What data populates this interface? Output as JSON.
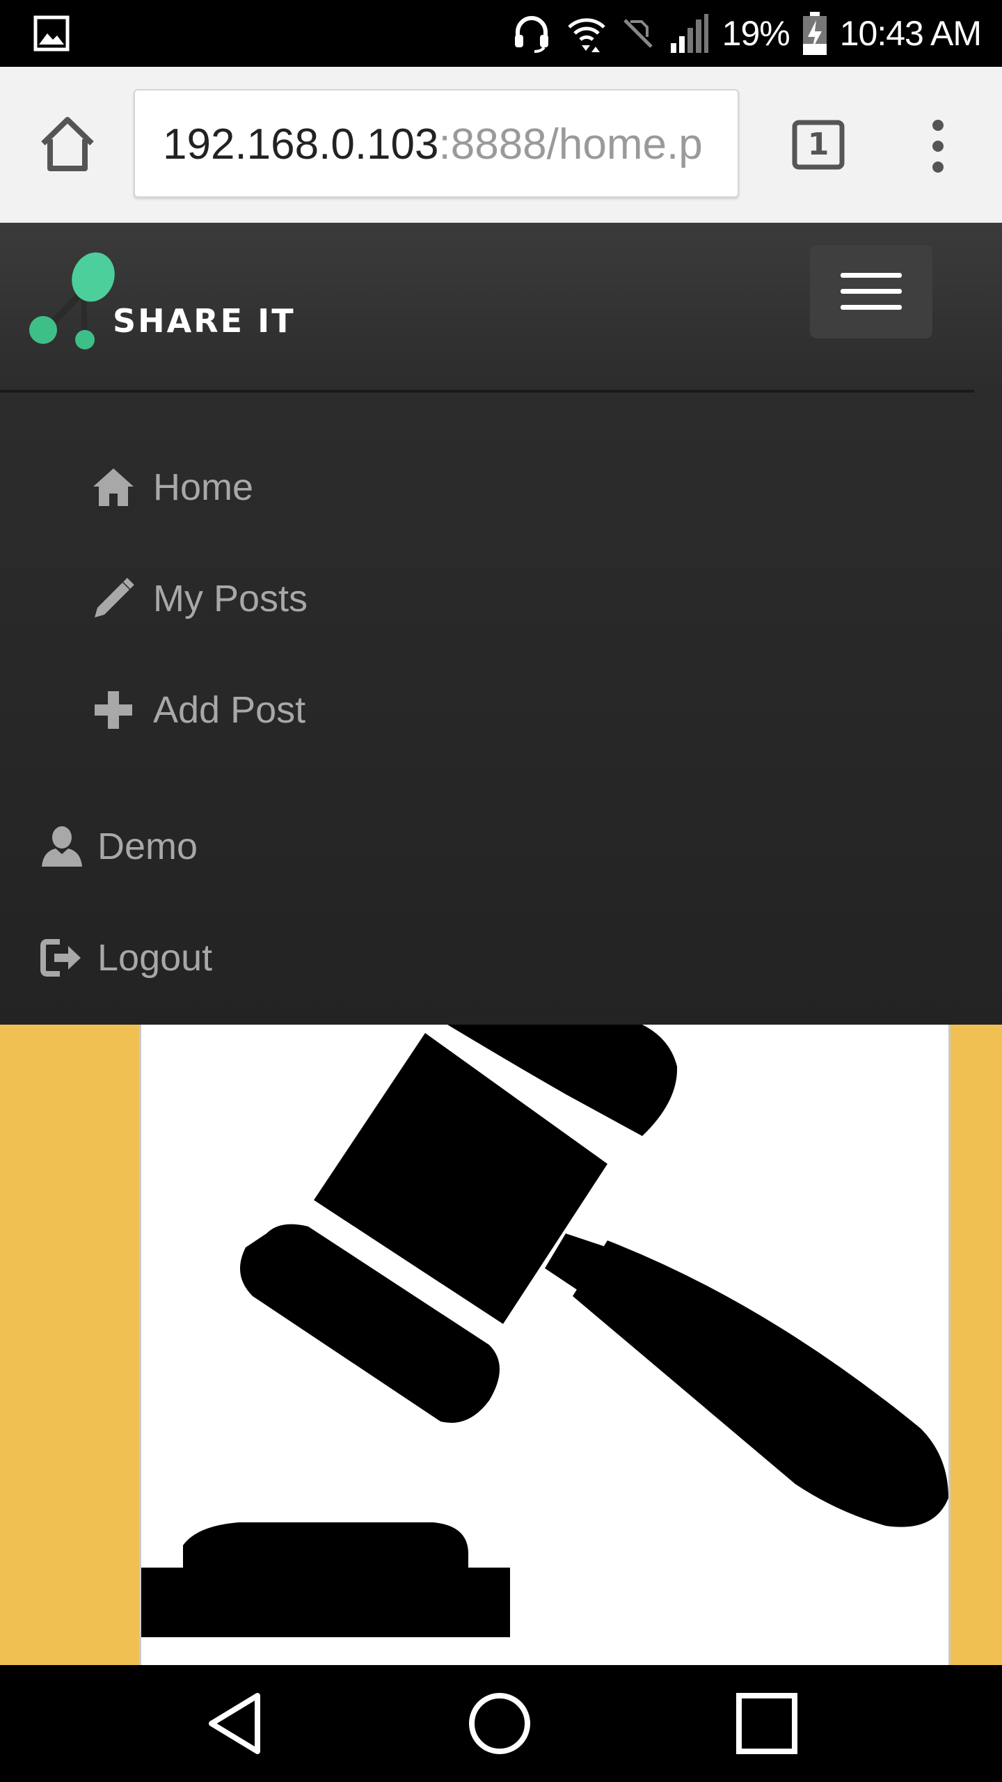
{
  "status_bar": {
    "battery": "19%",
    "time": "10:43 AM",
    "icons": [
      "image-notification-icon",
      "headset-icon",
      "wifi-icon",
      "no-sim-icon",
      "signal-icon",
      "battery-charging-icon"
    ]
  },
  "browser": {
    "url_host": "192.168.0.103",
    "url_rest": ":8888/home.p",
    "tab_count": "1"
  },
  "site": {
    "brand": "SHARE IT",
    "accent_color": "#4ccf9b",
    "nav_items": [
      {
        "label": "Home",
        "icon": "home-icon"
      },
      {
        "label": "My Posts",
        "icon": "pencil-icon"
      },
      {
        "label": "Add Post",
        "icon": "plus-icon"
      }
    ],
    "user_items": [
      {
        "label": "Demo",
        "icon": "user-icon"
      },
      {
        "label": "Logout",
        "icon": "logout-icon"
      }
    ]
  },
  "content": {
    "background_color": "#f0c152",
    "post_image": "gavel-icon"
  },
  "system_nav": [
    "back-icon",
    "home-circle-icon",
    "recents-icon"
  ]
}
